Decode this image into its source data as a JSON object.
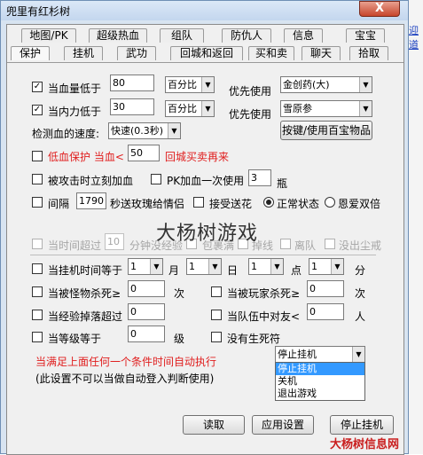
{
  "window": {
    "title": "兜里有红杉树",
    "close_label": "X"
  },
  "side_link": "迎道",
  "tabs_row1": [
    "地图/PK",
    "超级热血",
    "组队",
    "防仇人",
    "信息",
    "宝宝"
  ],
  "tabs_row2": [
    "保护",
    "挂机",
    "武功",
    "回城和返回",
    "买和卖",
    "聊天",
    "拾取"
  ],
  "hp": {
    "label": "当血量低于",
    "value": "80",
    "unit": "百分比",
    "use_label": "优先使用",
    "item": "金创药(大)",
    "checked": "✓"
  },
  "mp": {
    "label": "当内力低于",
    "value": "30",
    "unit": "百分比",
    "use_label": "优先使用",
    "item": "雪原参",
    "checked": "✓"
  },
  "speed": {
    "label": "检测血的速度:",
    "value": "快速(0.3秒)",
    "hotkey_button": "按键/使用百宝物品"
  },
  "low_hp": {
    "label_a": "低血保护 当血<",
    "value": "50",
    "label_b": "回城买卖再来"
  },
  "hit_add": {
    "label": "被攻击时立刻加血",
    "pk_label": "PK加血一次使用",
    "pk_value": "3",
    "pk_unit": "瓶"
  },
  "gift": {
    "label": "间隔",
    "value": "1790",
    "label_b": "秒送玫瑰给情侣",
    "accept_label": "接受送花",
    "mode_normal": "正常状态",
    "mode_love": "恩爱双倍"
  },
  "dim_row": {
    "a": "当时间超过",
    "value": "10",
    "b": "分钟没经验",
    "c": "包裹满",
    "d": "掉线",
    "e": "离队",
    "f": "没出尘戒"
  },
  "watermark": "大杨树游戏",
  "time_row": {
    "label": "当挂机时间等于",
    "month_val": "1",
    "month": "月",
    "day_val": "1",
    "day": "日",
    "hour_val": "1",
    "hour": "点",
    "min_val": "1",
    "min": "分"
  },
  "kill_row": {
    "monster_label": "当被怪物杀死≥",
    "monster_val": "0",
    "unit_a": "次",
    "player_label": "当被玩家杀死≥",
    "player_val": "0",
    "unit_b": "次"
  },
  "exp_row": {
    "label": "当经验掉落超过",
    "value": "0",
    "team_label": "当队伍中对友<",
    "team_val": "0",
    "unit": "人"
  },
  "level_row": {
    "label": "当等级等于",
    "value": "0",
    "unit": "级",
    "no_res": "没有生死符"
  },
  "action": {
    "text": "当满足上面任何一个条件时间自动执行",
    "note": "(此设置不可以当做自动登入判断使用)",
    "selected": "停止挂机",
    "options": [
      "停止挂机",
      "关机",
      "退出游戏"
    ]
  },
  "buttons": {
    "read": "读取",
    "apply": "应用设置",
    "stop": "停止挂机"
  },
  "watermark_corner": "大杨树信息网"
}
